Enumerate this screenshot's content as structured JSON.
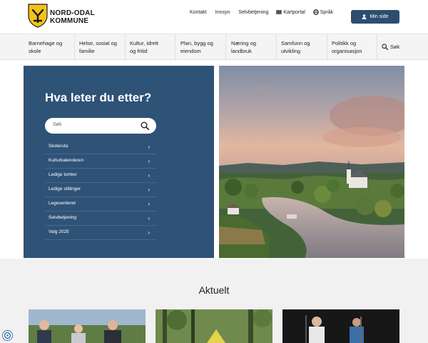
{
  "header": {
    "logo_line1": "NORD-ODAL",
    "logo_line2": "KOMMUNE",
    "util_links": [
      "Kontakt",
      "Innsyn",
      "Selvbetjening",
      "Kartportal",
      "Språk"
    ],
    "my_page_label": "Min side"
  },
  "nav": {
    "items": [
      {
        "line1": "Barnehage og",
        "line2": "skole"
      },
      {
        "line1": "Helse, sosial og",
        "line2": "familie"
      },
      {
        "line1": "Kultur, idrett",
        "line2": "og fritid"
      },
      {
        "line1": "Plan, bygg og",
        "line2": "eiendom"
      },
      {
        "line1": "Næring og",
        "line2": "landbruk"
      },
      {
        "line1": "Samfunn og",
        "line2": "utvikling"
      },
      {
        "line1": "Politikk og",
        "line2": "organisasjon"
      }
    ],
    "search_label": "Søk"
  },
  "hero": {
    "title": "Hva leter du etter?",
    "search_placeholder": "Søk",
    "quick_links": [
      "Skoleruta",
      "Kulturkalenderen",
      "Ledige tomter",
      "Ledige stillinger",
      "Legesenteret",
      "Selvbetjening",
      "Valg 2025"
    ]
  },
  "news": {
    "title": "Aktuelt"
  },
  "colors": {
    "brand_blue": "#2f5277",
    "button_blue": "#2c4e6e",
    "logo_yellow": "#f2c21b"
  }
}
